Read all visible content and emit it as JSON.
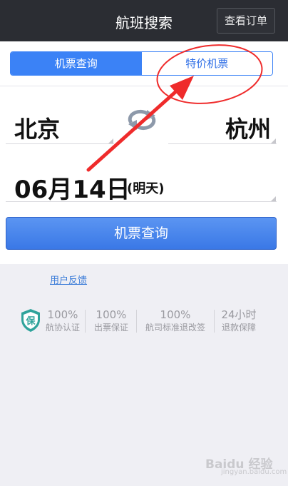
{
  "header": {
    "title": "航班搜索",
    "orders_label": "查看订单"
  },
  "tabs": [
    {
      "label": "机票查询",
      "active": true
    },
    {
      "label": "特价机票",
      "active": false
    }
  ],
  "search": {
    "from_city": "北京",
    "to_city": "杭州",
    "date": "06月14日",
    "date_note": "(明天)",
    "button_label": "机票查询"
  },
  "feedback_link": "用户反馈",
  "guarantees": [
    {
      "top": "100%",
      "bottom": "航协认证"
    },
    {
      "top": "100%",
      "bottom": "出票保证"
    },
    {
      "top": "100%",
      "bottom": "航司标准退改签"
    },
    {
      "top": "24小时",
      "bottom": "退款保障"
    }
  ],
  "shield_icon_text": "保",
  "watermark": {
    "text": "Baidu 经验",
    "sub": "jingyan.baidu.com"
  },
  "colors": {
    "header_bg": "#2b2d33",
    "accent": "#3b82f6",
    "annotation_red": "#ef2b2b"
  },
  "icons": [
    "swap-icon",
    "shield-icon",
    "annotation-arrow",
    "annotation-ellipse"
  ]
}
